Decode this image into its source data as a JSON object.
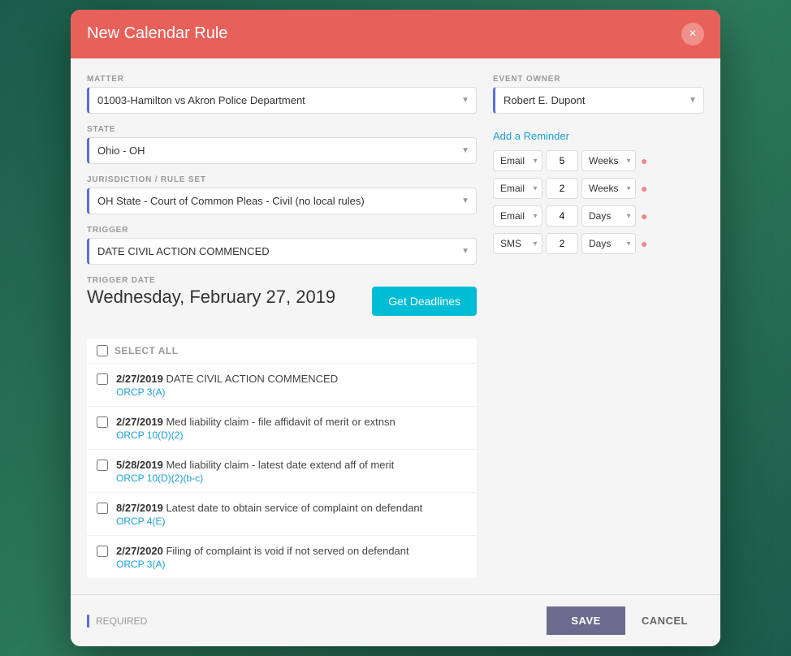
{
  "modal": {
    "title": "New Calendar Rule",
    "close_label": "×"
  },
  "matter": {
    "label": "MATTER",
    "value": "01003-Hamilton vs Akron Police Department"
  },
  "state": {
    "label": "STATE",
    "value": "Ohio - OH"
  },
  "jurisdiction": {
    "label": "JURISDICTION / RULE SET",
    "value": "OH State - Court of Common Pleas - Civil (no local rules)"
  },
  "trigger": {
    "label": "TRIGGER",
    "value": "DATE CIVIL ACTION COMMENCED"
  },
  "trigger_date": {
    "label": "TRIGGER DATE",
    "value": "Wednesday, February 27, 2019"
  },
  "get_deadlines_btn": "Get Deadlines",
  "select_all_label": "SELECT ALL",
  "deadlines": [
    {
      "date": "2/27/2019",
      "description": "  DATE CIVIL ACTION COMMENCED",
      "rule": "ORCP 3(A)"
    },
    {
      "date": "2/27/2019",
      "description": "  Med liability claim - file affidavit of merit or extnsn",
      "rule": "ORCP 10(D)(2)"
    },
    {
      "date": "5/28/2019",
      "description": "  Med liability claim - latest date extend aff of merit",
      "rule": "ORCP 10(D)(2)(b-c)"
    },
    {
      "date": "8/27/2019",
      "description": "  Latest date to obtain service of complaint on defendant",
      "rule": "ORCP 4(E)"
    },
    {
      "date": "2/27/2020",
      "description": "  Filing of complaint is void if not served on defendant",
      "rule": "ORCP 3(A)"
    }
  ],
  "event_owner": {
    "label": "EVENT OWNER",
    "value": "Robert E. Dupont"
  },
  "add_reminder": {
    "label": "Add a Reminder"
  },
  "reminders": [
    {
      "type": "Email",
      "number": "5",
      "unit": "Weeks"
    },
    {
      "type": "Email",
      "number": "2",
      "unit": "Weeks"
    },
    {
      "type": "Email",
      "number": "4",
      "unit": "Days"
    },
    {
      "type": "SMS",
      "number": "2",
      "unit": "Days"
    }
  ],
  "footer": {
    "required_label": "REQUIRED",
    "save_label": "SAVE",
    "cancel_label": "CANCEL"
  }
}
